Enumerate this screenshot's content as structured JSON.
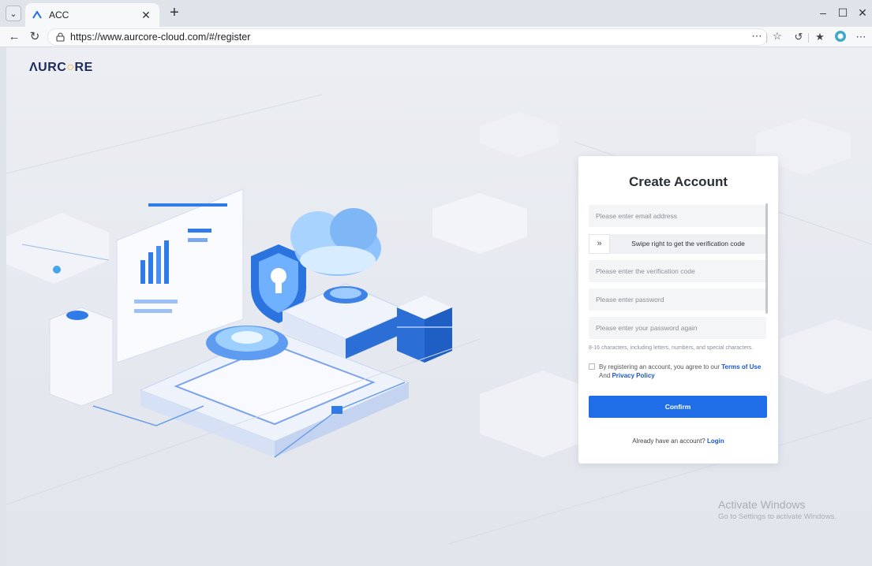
{
  "browser": {
    "tab_title": "ACC",
    "url": "https://www.aurcore-cloud.com/#/register"
  },
  "page": {
    "logo": {
      "prefix": "ΛURC",
      "mark": "○",
      "suffix": "RE"
    }
  },
  "register": {
    "title": "Create Account",
    "email_placeholder": "Please enter email address",
    "slider_text": "Swipe right to get the verification code",
    "verification_placeholder": "Please enter the verification code",
    "password_placeholder": "Please enter password",
    "password_again_placeholder": "Please enter your password again",
    "password_hint": "8-16 characters, including letters, numbers, and special characters.",
    "agree_prefix": "By registering an account, you agree to our",
    "terms_link": "Terms of Use",
    "agree_and": "And",
    "privacy_link": "Privacy Policy",
    "confirm_label": "Confirm",
    "login_prompt": "Already have an account?",
    "login_link": "Login"
  },
  "watermark": {
    "title": "Activate Windows",
    "subtitle": "Go to Settings to activate Windows."
  },
  "colors": {
    "accent": "#1f6ee8",
    "link": "#1a56c9",
    "logo": "#1d2b5a",
    "logo_mark": "#f0b429"
  }
}
